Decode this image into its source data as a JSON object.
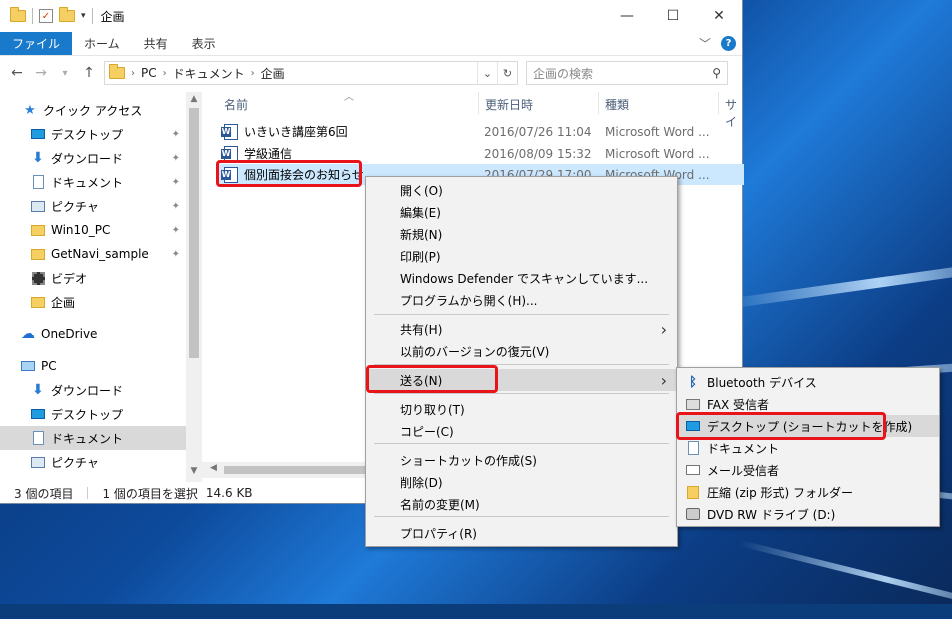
{
  "window": {
    "title": "企画",
    "min_label": "—",
    "max_label": "☐",
    "close_label": "✕"
  },
  "ribbon": {
    "tabs": [
      "ファイル",
      "ホーム",
      "共有",
      "表示"
    ],
    "collapse_label": "﹀",
    "help_label": "?"
  },
  "address": {
    "crumbs": [
      "PC",
      "ドキュメント",
      "企画"
    ],
    "search_placeholder": "企画の検索"
  },
  "nav": {
    "items": [
      {
        "label": "クイック アクセス",
        "icon": "star-icon"
      },
      {
        "label": "デスクトップ",
        "icon": "desktop-icon",
        "pinned": true
      },
      {
        "label": "ダウンロード",
        "icon": "download-icon",
        "pinned": true
      },
      {
        "label": "ドキュメント",
        "icon": "document-icon",
        "pinned": true
      },
      {
        "label": "ピクチャ",
        "icon": "picture-icon",
        "pinned": true
      },
      {
        "label": "Win10_PC",
        "icon": "folder-icon",
        "pinned": true
      },
      {
        "label": "GetNavi_sample",
        "icon": "folder-icon",
        "pinned": true
      },
      {
        "label": "ビデオ",
        "icon": "video-icon"
      },
      {
        "label": "企画",
        "icon": "folder-icon"
      },
      {
        "label": "OneDrive",
        "icon": "cloud-icon"
      },
      {
        "label": "PC",
        "icon": "pc-icon"
      },
      {
        "label": "ダウンロード",
        "icon": "download-icon"
      },
      {
        "label": "デスクトップ",
        "icon": "desktop-icon"
      },
      {
        "label": "ドキュメント",
        "icon": "document-icon",
        "selected": true
      },
      {
        "label": "ピクチャ",
        "icon": "picture-icon"
      }
    ]
  },
  "columns": {
    "name": "名前",
    "date": "更新日時",
    "type": "種類",
    "size": "サイ"
  },
  "files": [
    {
      "name": "いきいき講座第6回",
      "date": "2016/07/26 11:04",
      "type": "Microsoft Word ..."
    },
    {
      "name": "学級通信",
      "date": "2016/08/09 15:32",
      "type": "Microsoft Word ..."
    },
    {
      "name": "個別面接会のお知らせ",
      "date": "2016/07/29 17:00",
      "type": "Microsoft Word ...",
      "selected": true
    }
  ],
  "status": {
    "count": "3 個の項目",
    "selected": "1 個の項目を選択",
    "size": "14.6 KB"
  },
  "context_menu": {
    "groups": [
      [
        "開く(O)",
        "編集(E)",
        "新規(N)",
        "印刷(P)",
        "Windows Defender でスキャンしています...",
        "プログラムから開く(H)..."
      ],
      [
        "共有(H)",
        "以前のバージョンの復元(V)"
      ],
      [
        "送る(N)"
      ],
      [
        "切り取り(T)",
        "コピー(C)"
      ],
      [
        "ショートカットの作成(S)",
        "削除(D)",
        "名前の変更(M)"
      ],
      [
        "プロパティ(R)"
      ]
    ]
  },
  "send_to_menu": {
    "items": [
      {
        "label": "Bluetooth デバイス",
        "icon": "bluetooth-icon"
      },
      {
        "label": "FAX 受信者",
        "icon": "fax-icon"
      },
      {
        "label": "デスクトップ (ショートカットを作成)",
        "icon": "desktop-icon",
        "hover": true
      },
      {
        "label": "ドキュメント",
        "icon": "document-icon"
      },
      {
        "label": "メール受信者",
        "icon": "mail-icon"
      },
      {
        "label": "圧縮 (zip 形式) フォルダー",
        "icon": "zip-folder-icon"
      },
      {
        "label": "DVD RW ドライブ (D:)",
        "icon": "dvd-drive-icon"
      }
    ]
  },
  "colors": {
    "accent": "#1979ca",
    "selection": "#cce8ff",
    "highlight": "#e8141a"
  }
}
